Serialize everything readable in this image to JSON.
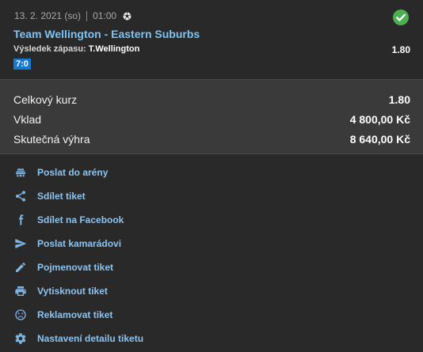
{
  "ticket": {
    "date": "13. 2. 2021 (so)",
    "time": "01:00",
    "sport_icon": "soccer-ball-icon",
    "status_icon": "check-circle-icon",
    "status_color": "#4caf50",
    "match": "Team Wellington - Eastern Suburbs",
    "bet_label": "Výsledek zápasu:",
    "bet_pick": "T.Wellington",
    "bet_odd": "1.80",
    "score": "7:0"
  },
  "summary": {
    "rows": [
      {
        "label": "Celkový kurz",
        "value": "1.80"
      },
      {
        "label": "Vklad",
        "value": "4 800,00 Kč"
      },
      {
        "label": "Skutečná výhra",
        "value": "8 640,00 Kč"
      }
    ]
  },
  "actions": [
    {
      "label": "Poslat do arény",
      "icon": "arena-icon"
    },
    {
      "label": "Sdílet tiket",
      "icon": "share-icon"
    },
    {
      "label": "Sdílet na Facebook",
      "icon": "facebook-icon"
    },
    {
      "label": "Poslat kamarádovi",
      "icon": "send-icon"
    },
    {
      "label": "Pojmenovat tiket",
      "icon": "pencil-icon"
    },
    {
      "label": "Vytisknout tiket",
      "icon": "printer-icon"
    },
    {
      "label": "Reklamovat tiket",
      "icon": "sad-face-icon"
    },
    {
      "label": "Nastavení detailu tiketu",
      "icon": "gear-icon"
    }
  ],
  "colors": {
    "accent": "#7dc4f5",
    "score_badge": "#1678d2",
    "background": "#292929",
    "summary_background": "#3a3a3a"
  }
}
